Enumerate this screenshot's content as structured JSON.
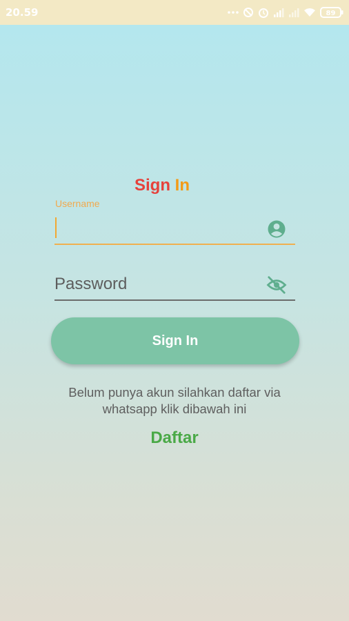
{
  "status_bar": {
    "time": "20.59",
    "battery": "89"
  },
  "login": {
    "title_part1": "Sign",
    "title_part2": "In",
    "username_label": "Username",
    "username_value": "",
    "password_placeholder": "Password",
    "signin_label": "Sign In",
    "info_text": "Belum punya akun silahkan daftar via whatsapp klik dibawah ini",
    "register_label": "Daftar"
  },
  "colors": {
    "accent": "#7dc4a6",
    "title_red": "#e6413b",
    "title_orange": "#f39b16",
    "register_green": "#4aa947",
    "focus_orange": "#f0b04e"
  },
  "icons": {
    "username": "account-circle-icon",
    "password": "visibility-off-icon"
  }
}
